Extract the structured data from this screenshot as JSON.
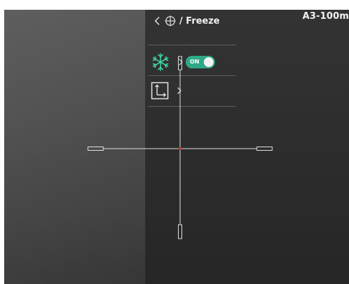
{
  "profile": {
    "label": "A3-100m"
  },
  "menu": {
    "back_icon": "chevron-left-icon",
    "reticle_icon": "reticle-crosshair-icon",
    "title": "/ Freeze",
    "rows": [
      {
        "icon": "snowflake-icon",
        "toggle": {
          "state": "ON",
          "color": "#2fa888"
        }
      },
      {
        "icon": "coordinate-axis-icon"
      }
    ]
  },
  "reticle": {
    "color": "#e0e0e0",
    "center_dot_color": "#c0392b"
  }
}
